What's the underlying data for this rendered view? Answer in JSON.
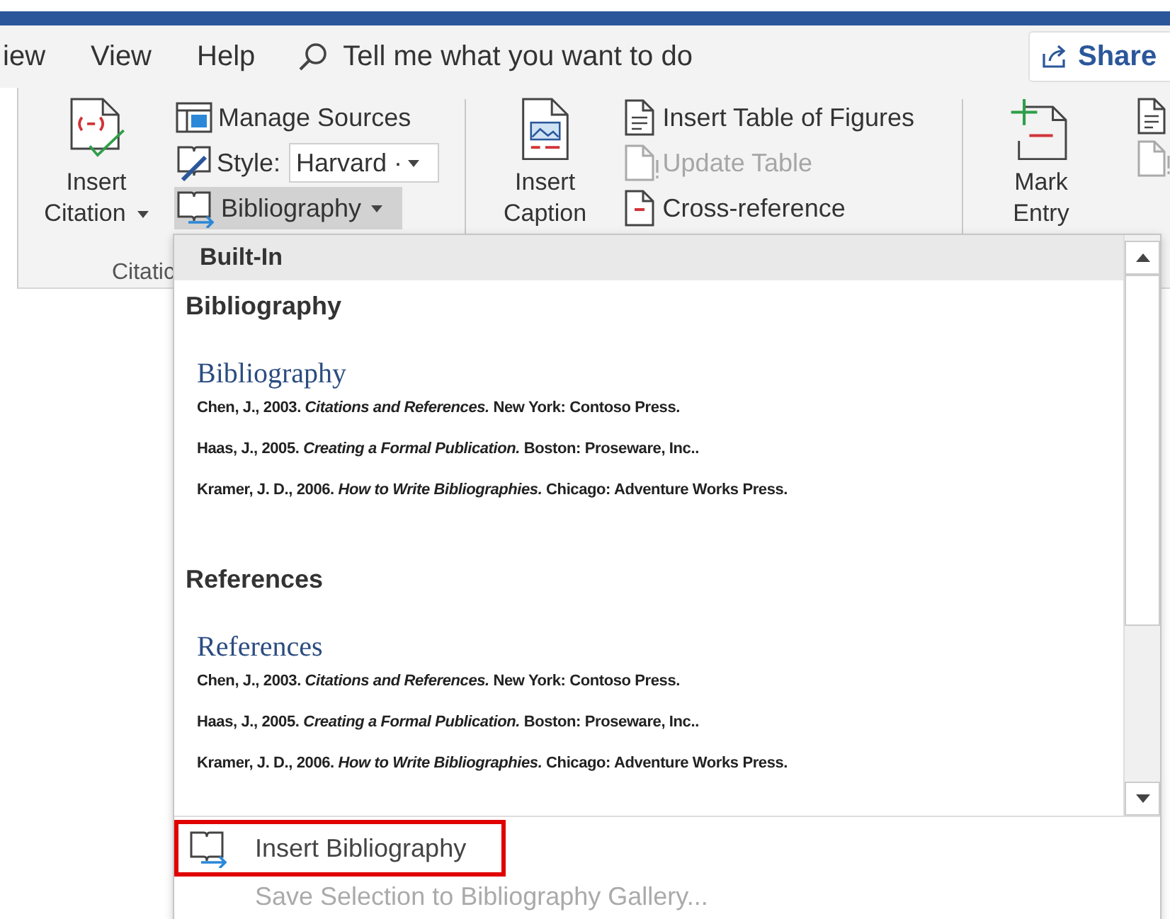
{
  "tabs": [
    "iew",
    "View",
    "Help"
  ],
  "search": {
    "placeholder": "Tell me what you want to do"
  },
  "share": {
    "label": "Share"
  },
  "ribbon": {
    "groups": [
      {
        "label": "Citatic",
        "large": {
          "lines": [
            "Insert",
            "Citation"
          ],
          "dropdown": true
        },
        "small": [
          {
            "kind": "button",
            "label": "Manage Sources",
            "disabled": false
          },
          {
            "kind": "dropdown",
            "label": "Style:",
            "value": "Harvard ·"
          },
          {
            "kind": "menu",
            "label": "Bibliography",
            "pressed": true
          }
        ]
      },
      {
        "large": {
          "lines": [
            "Insert",
            "Caption"
          ],
          "dropdown": false
        },
        "small": [
          {
            "kind": "button",
            "label": "Insert Table of Figures",
            "disabled": false
          },
          {
            "kind": "button",
            "label": "Update Table",
            "disabled": true
          },
          {
            "kind": "button",
            "label": "Cross-reference",
            "disabled": false
          }
        ]
      },
      {
        "large": {
          "lines": [
            "Mark",
            "Entry"
          ],
          "dropdown": false
        },
        "small": [
          {
            "kind": "icon",
            "disabled": false
          },
          {
            "kind": "icon",
            "disabled": true
          }
        ]
      }
    ]
  },
  "menu": {
    "header": "Built-In",
    "sections": [
      {
        "heading": "Bibliography",
        "preview": {
          "title": "Bibliography",
          "entries": [
            "Chen, J., 2003. *Citations and References.* New York: Contoso Press.",
            "Haas, J., 2005. *Creating a Formal Publication.* Boston: Proseware, Inc..",
            "Kramer, J. D., 2006. *How to Write Bibliographies.* Chicago: Adventure Works Press."
          ]
        }
      },
      {
        "heading": "References",
        "preview": {
          "title": "References",
          "entries": [
            "Chen, J., 2003. *Citations and References.* New York: Contoso Press.",
            "Haas, J., 2005. *Creating a Formal Publication.* Boston: Proseware, Inc..",
            "Kramer, J. D., 2006. *How to Write Bibliographies.* Chicago: Adventure Works Press."
          ]
        }
      }
    ],
    "actions": [
      {
        "label": "Insert Bibliography",
        "disabled": false,
        "highlighted": true
      },
      {
        "label": "Save Selection to Bibliography Gallery...",
        "disabled": true,
        "highlighted": false
      }
    ]
  }
}
